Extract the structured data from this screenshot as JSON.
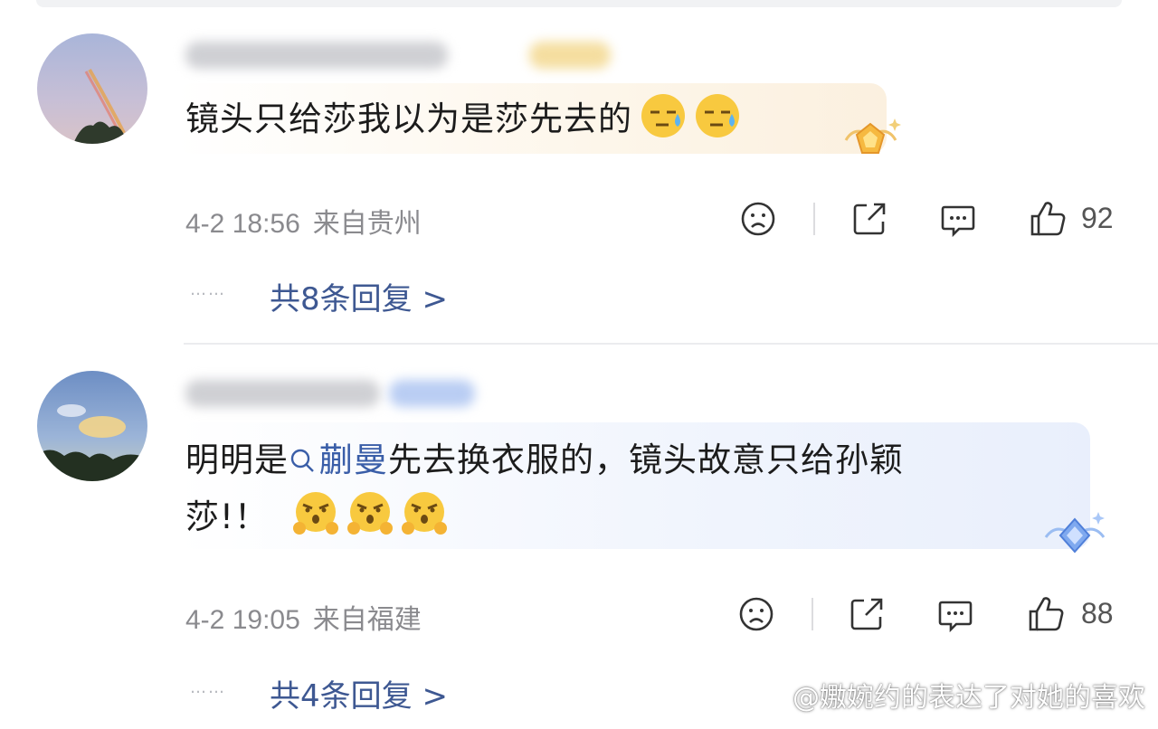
{
  "comments": [
    {
      "text": "镜头只给莎我以为是莎先去的",
      "emojis": [
        "sweat-smile-emoji",
        "sweat-smile-emoji"
      ],
      "date": "4-2 18:56",
      "location": "来自贵州",
      "likes": "92",
      "replies": "共8条回复 >",
      "dots": "……"
    },
    {
      "text_before": "明明是",
      "topic": "蒯曼",
      "text_after_line1": "先去换衣服的，镜头故意只给孙颖",
      "text_line2": "莎!！",
      "emojis": [
        "angry-emoji",
        "angry-emoji",
        "angry-emoji"
      ],
      "date": "4-2 19:05",
      "location": "来自福建",
      "likes": "88",
      "replies": "共4条回复 >",
      "dots": "……"
    }
  ],
  "watermark": "@嫐婉约的表达了对她的喜欢",
  "colors": {
    "reply_link": "#3e5892",
    "topic": "#3a5ea8",
    "meta": "#8a8a8e"
  }
}
